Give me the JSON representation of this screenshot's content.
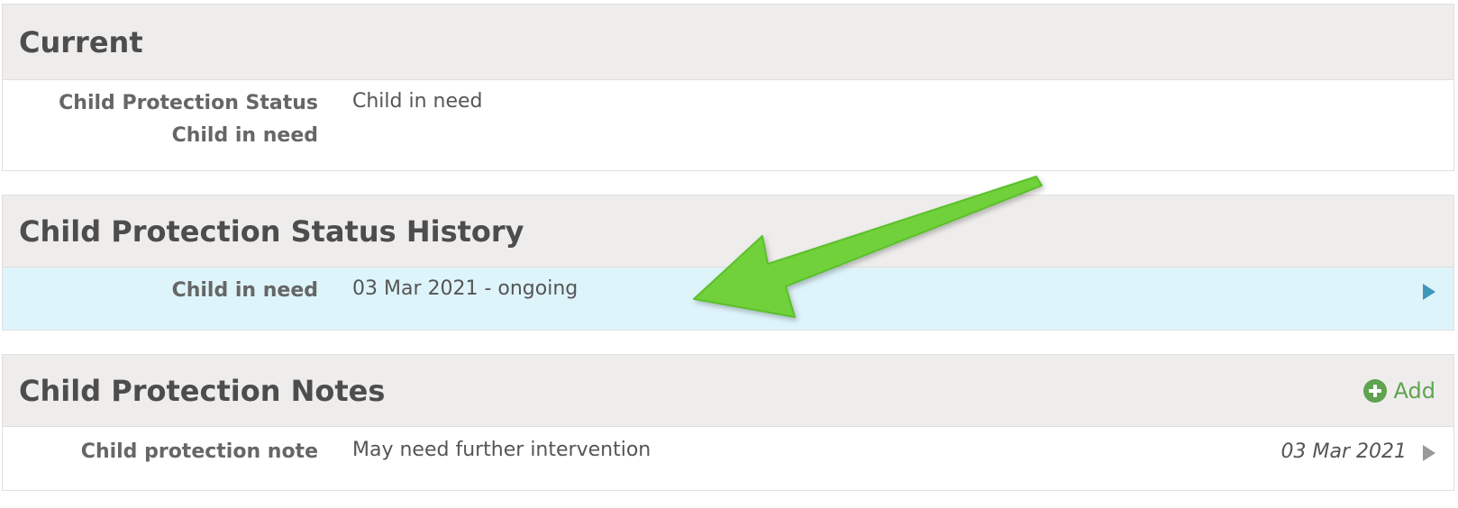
{
  "current": {
    "title": "Current",
    "row": {
      "label": "Child Protection Status Child in need",
      "value": "Child in need"
    }
  },
  "history": {
    "title": "Child Protection Status History",
    "row": {
      "label": "Child in need",
      "value": "03 Mar 2021 - ongoing"
    }
  },
  "notes": {
    "title": "Child Protection Notes",
    "add_label": "Add",
    "row": {
      "label": "Child protection note",
      "value": "May need further intervention",
      "date": "03 Mar 2021"
    }
  },
  "colors": {
    "header_bg": "#eeedec",
    "highlight_bg": "#def4fb",
    "add_green": "#5fa350",
    "annotation_arrow": "#6fd13a",
    "chevron_blue": "#3e97b8"
  }
}
